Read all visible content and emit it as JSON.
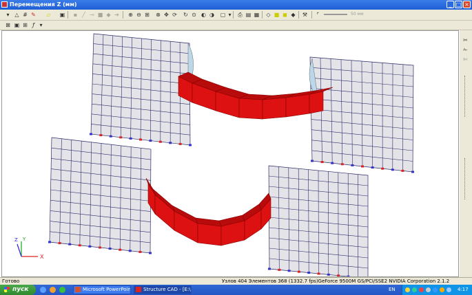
{
  "window": {
    "title": "Перемещения Z (мм)"
  },
  "toolbar": {
    "slider_label": "50 мм"
  },
  "viewport": {
    "axes": {
      "x": "X",
      "y": "Y",
      "z": "Z"
    },
    "colors": {
      "grid_fill": "#e4e4e8",
      "grid_line": "#2a2a6a",
      "beam_fill": "#dd1111",
      "beam_stroke": "#880000",
      "deform": "#bcd8e8"
    }
  },
  "status": {
    "ready": "Готово",
    "info": "Узлов 404  Элементов 368  (1332.7 fps)GeForce 9500M GS/PCI/SSE2 NVIDIA Corporation 2.1.2"
  },
  "taskbar": {
    "start": "пуск",
    "tasks": [
      {
        "label": "Microsoft PowerPoint ..."
      },
      {
        "label": "Structure CAD - [E:\\..."
      }
    ],
    "lang": "EN",
    "clock": "4:17"
  }
}
